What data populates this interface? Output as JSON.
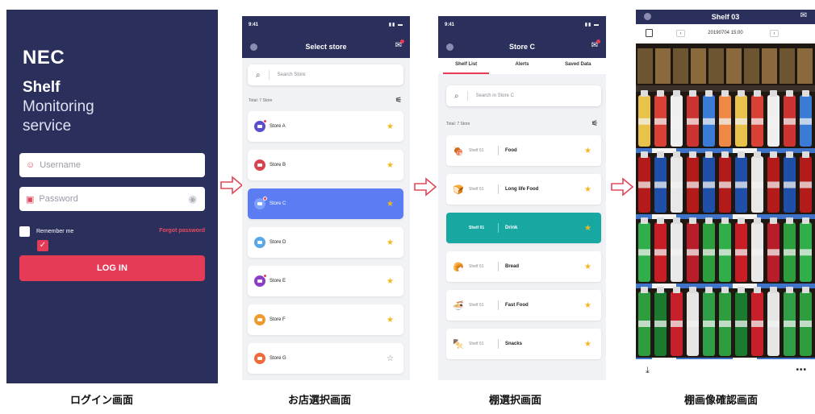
{
  "login": {
    "logo": "NEC",
    "title_line1": "Shelf",
    "title_line2": "Monitoring",
    "title_line3": "service",
    "username_placeholder": "Username",
    "password_placeholder": "Password",
    "remember_label": "Remember me",
    "forgot_label": "Forgot password",
    "login_button": "LOG IN",
    "caption": "ログイン画面"
  },
  "store_select": {
    "status_time": "9:41",
    "title": "Select store",
    "search_placeholder": "Search Store",
    "total": "Total: 7 Store",
    "stores": [
      {
        "name": "Store A",
        "color": "#5b4fd0",
        "favorite": true,
        "badge": true
      },
      {
        "name": "Store B",
        "color": "#d9454f",
        "favorite": true,
        "badge": false
      },
      {
        "name": "Store C",
        "color": "#ffffff",
        "favorite": true,
        "badge": true
      },
      {
        "name": "Store D",
        "color": "#5aa7e8",
        "favorite": true,
        "badge": false
      },
      {
        "name": "Store E",
        "color": "#8b3fc7",
        "favorite": true,
        "badge": true
      },
      {
        "name": "Store F",
        "color": "#ee9a2c",
        "favorite": true,
        "badge": false
      },
      {
        "name": "Store G",
        "color": "#f06a3a",
        "favorite": false,
        "badge": false
      }
    ],
    "active_store": "Store C",
    "caption": "お店選択画面"
  },
  "shelf_select": {
    "status_time": "9:41",
    "title": "Store C",
    "tabs": [
      "Shelf List",
      "Alerts",
      "Saved Data"
    ],
    "search_placeholder": "Search in Store C",
    "total": "Total: 7 Store",
    "shelves": [
      {
        "shelf": "Shelf 01",
        "name": "Food",
        "icon": "meat-icon",
        "glyph": "🍖"
      },
      {
        "shelf": "Shelf 01",
        "name": "Long life Food",
        "icon": "bread-loaf-icon",
        "glyph": "🍞"
      },
      {
        "shelf": "Shelf 01",
        "name": "Drink",
        "icon": "drink-icon",
        "glyph": ""
      },
      {
        "shelf": "Shelf 01",
        "name": "Bread",
        "icon": "bread-icon",
        "glyph": "🥐"
      },
      {
        "shelf": "Shelf 01",
        "name": "Fast Food",
        "icon": "bowl-icon",
        "glyph": "🍜"
      },
      {
        "shelf": "Shelf 01",
        "name": "Snacks",
        "icon": "skewer-icon",
        "glyph": "🍢"
      }
    ],
    "active_shelf": "Drink",
    "caption": "棚選択画面"
  },
  "shelf_image": {
    "title": "Shelf 03",
    "datetime": "20190704 15:00",
    "prev": "‹",
    "next": "›",
    "more": "•••",
    "caption": "棚画像確認画面"
  },
  "colors": {
    "navy": "#2b2f5c",
    "accent_red": "#e53b56",
    "active_blue": "#5b7cf2",
    "active_teal": "#17a8a2",
    "star": "#f5b818"
  }
}
